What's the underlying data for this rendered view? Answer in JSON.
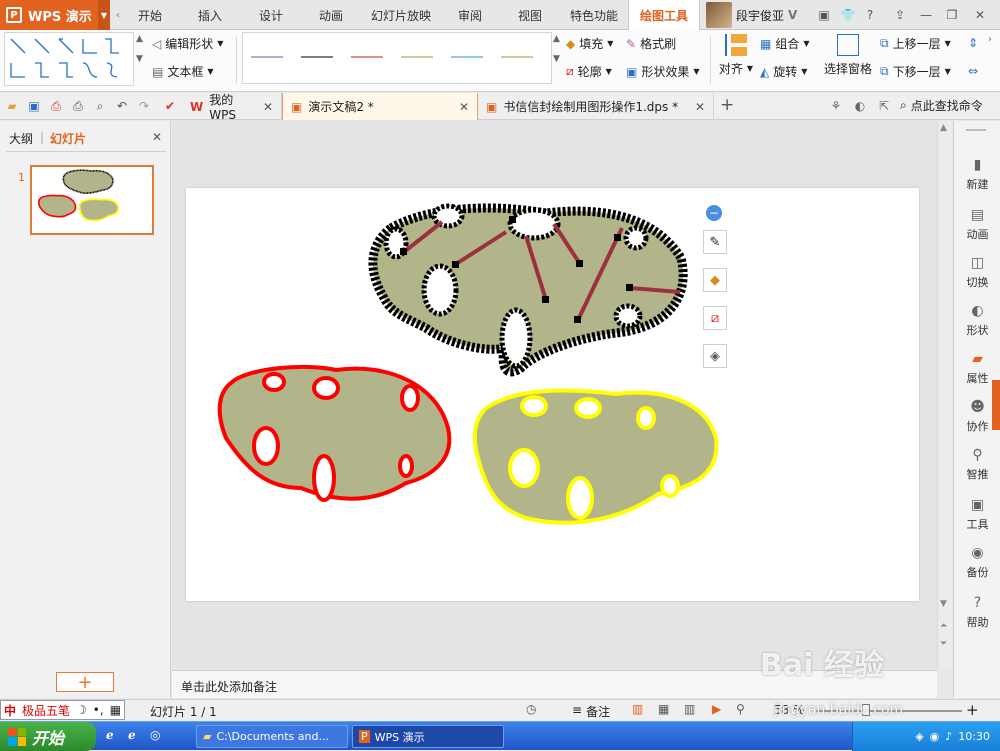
{
  "app": {
    "name": "WPS 演示",
    "logo_glyph": "P"
  },
  "menu_tabs": [
    "开始",
    "插入",
    "设计",
    "动画",
    "幻灯片放映",
    "审阅",
    "视图",
    "特色功能",
    "绘图工具"
  ],
  "active_menu_tab": "绘图工具",
  "user": {
    "name": "段宇俊亚",
    "badge": "V"
  },
  "window_controls": [
    "minimize",
    "restore",
    "close"
  ],
  "ribbon": {
    "edit_shape": "编辑形状",
    "textbox": "文本框",
    "fill": "填充",
    "format_painter": "格式刷",
    "outline": "轮廓",
    "shape_effects": "形状效果",
    "align": "对齐",
    "group": "组合",
    "rotate": "旋转",
    "selection_pane": "选择窗格",
    "bring_forward": "上移一层",
    "send_backward": "下移一层",
    "line_style_colors": [
      "#8a7bb5",
      "#333333",
      "#c0504d",
      "#9bbb59",
      "#4bacc6",
      "#9bbb59"
    ]
  },
  "doc_tabs": [
    {
      "label": "我的WPS",
      "active": false
    },
    {
      "label": "演示文稿2 *",
      "active": true
    },
    {
      "label": "书信信封绘制用图形操作1.dps *",
      "active": false
    }
  ],
  "search_command": "点此查找命令",
  "left_panel": {
    "outline_tab": "大纲",
    "slides_tab": "幻灯片",
    "slide_number": "1",
    "add_label": "+"
  },
  "notes_placeholder": "单击此处添加备注",
  "right_panel": [
    "新建",
    "动画",
    "切换",
    "形状",
    "属性",
    "协作",
    "智推",
    "工具",
    "备份",
    "帮助"
  ],
  "status": {
    "slide_info": "幻灯片 1 / 1",
    "notes_btn": "备注",
    "zoom": "58 %"
  },
  "ime": {
    "name": "极品五笔",
    "logo": "中"
  },
  "taskbar": {
    "start": "开始",
    "items": [
      {
        "label": "C:\\Documents and...",
        "active": false
      },
      {
        "label": "WPS 演示",
        "active": true
      }
    ],
    "clock": "10:30"
  },
  "watermark": {
    "text": "Bai 经验",
    "sub": "jingyan.baidu.com"
  },
  "colors": {
    "accent": "#e2631f",
    "shape_fill": "#b2b48a",
    "red_outline": "#ff0000",
    "yellow_outline": "#ffff00",
    "connector": "#9c3040"
  }
}
